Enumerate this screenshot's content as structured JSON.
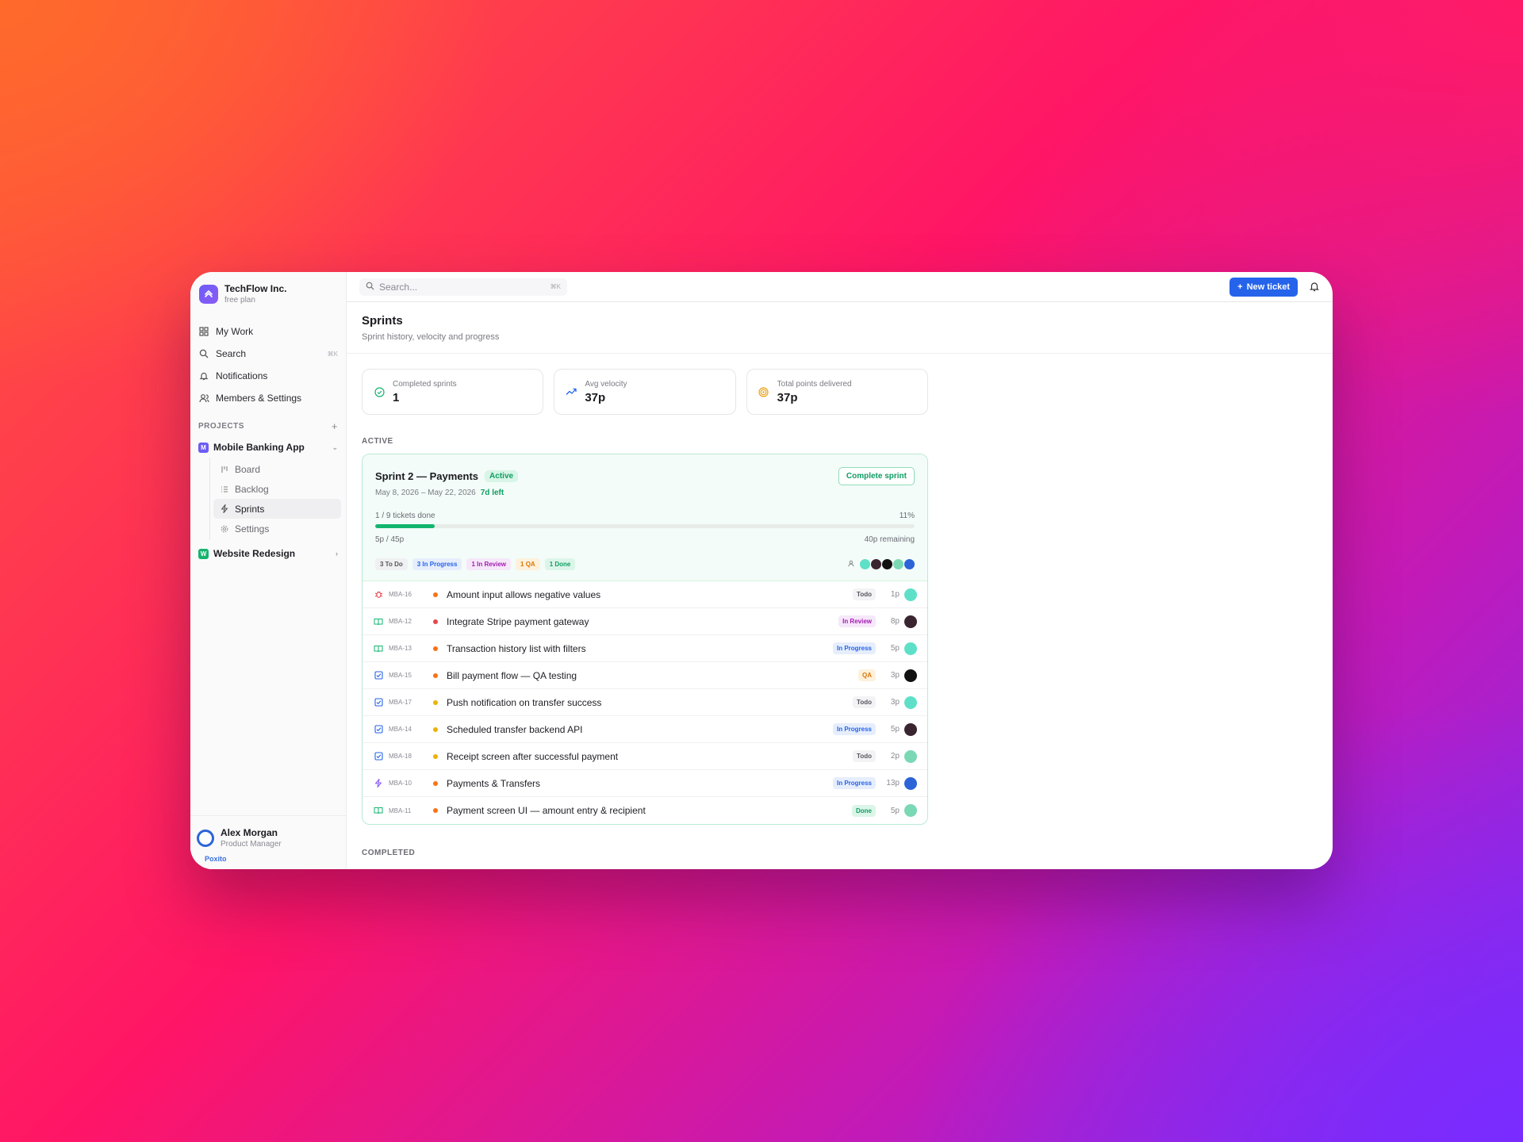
{
  "org": {
    "name": "TechFlow Inc.",
    "plan": "free plan"
  },
  "nav": [
    {
      "label": "My Work",
      "icon": "grid-icon"
    },
    {
      "label": "Search",
      "icon": "search-icon",
      "kbd": "⌘K"
    },
    {
      "label": "Notifications",
      "icon": "bell-icon"
    },
    {
      "label": "Members & Settings",
      "icon": "users-icon"
    }
  ],
  "projects_label": "PROJECTS",
  "projects": [
    {
      "name": "Mobile Banking App",
      "badge": "M",
      "color": "#6d5cf6",
      "subnav": [
        {
          "label": "Board"
        },
        {
          "label": "Backlog"
        },
        {
          "label": "Sprints",
          "active": true
        },
        {
          "label": "Settings"
        }
      ]
    },
    {
      "name": "Website Redesign",
      "badge": "W",
      "color": "#16b36e"
    }
  ],
  "user": {
    "name": "Alex Morgan",
    "role": "Product Manager",
    "brand": "Poxito"
  },
  "topbar": {
    "search_placeholder": "Search...",
    "search_kbd": "⌘K",
    "new_ticket": "New ticket"
  },
  "page": {
    "title": "Sprints",
    "subtitle": "Sprint history, velocity and progress"
  },
  "stats": [
    {
      "label": "Completed sprints",
      "value": "1",
      "icon": "check-circle-icon",
      "color": "#13b56f"
    },
    {
      "label": "Avg velocity",
      "value": "37p",
      "icon": "trend-up-icon",
      "color": "#2563eb"
    },
    {
      "label": "Total points delivered",
      "value": "37p",
      "icon": "target-icon",
      "color": "#e8a317"
    }
  ],
  "active_label": "ACTIVE",
  "sprint": {
    "name": "Sprint 2 — Payments",
    "status": "Active",
    "complete_label": "Complete sprint",
    "dates": "May 8, 2026 – May 22, 2026",
    "days_left": "7d left",
    "tickets_done": "1 / 9 tickets done",
    "percent_label": "11%",
    "progress_fraction": 0.11,
    "points": "5p / 45p",
    "remaining": "40p remaining",
    "chips": [
      {
        "label": "3 To Do",
        "color": "#55555e",
        "bg": "#f0f0f2"
      },
      {
        "label": "3 In Progress",
        "color": "#2563eb",
        "bg": "#e6eefc"
      },
      {
        "label": "1 In Review",
        "color": "#a21caf",
        "bg": "#f6e7fa"
      },
      {
        "label": "1 QA",
        "color": "#d97706",
        "bg": "#fdf1dc"
      },
      {
        "label": "1 Done",
        "color": "#0f9d63",
        "bg": "#dcf5e9"
      }
    ],
    "avatar_colors": [
      "#5ee0c8",
      "#3a2430",
      "#111111",
      "#7bd8b5",
      "#2c64d8"
    ]
  },
  "tickets": [
    {
      "id": "MBA-16",
      "type": "bug-icon",
      "type_color": "#e5484d",
      "prio": "#f97316",
      "title": "Amount input allows negative values",
      "status": "Todo",
      "s_color": "#55555e",
      "s_bg": "#f3f3f5",
      "points": "1p",
      "avatar": "#5ee0c8"
    },
    {
      "id": "MBA-12",
      "type": "story-icon",
      "type_color": "#13b56f",
      "prio": "#e5484d",
      "title": "Integrate Stripe payment gateway",
      "status": "In Review",
      "s_color": "#a21caf",
      "s_bg": "#f6e7fa",
      "points": "8p",
      "avatar": "#3a2430"
    },
    {
      "id": "MBA-13",
      "type": "story-icon",
      "type_color": "#13b56f",
      "prio": "#f97316",
      "title": "Transaction history list with filters",
      "status": "In Progress",
      "s_color": "#2563eb",
      "s_bg": "#e6eefc",
      "points": "5p",
      "avatar": "#5ee0c8"
    },
    {
      "id": "MBA-15",
      "type": "task-icon",
      "type_color": "#2563eb",
      "prio": "#f97316",
      "title": "Bill payment flow — QA testing",
      "status": "QA",
      "s_color": "#d97706",
      "s_bg": "#fdf1dc",
      "points": "3p",
      "avatar": "#111111"
    },
    {
      "id": "MBA-17",
      "type": "task-icon",
      "type_color": "#2563eb",
      "prio": "#eab308",
      "title": "Push notification on transfer success",
      "status": "Todo",
      "s_color": "#55555e",
      "s_bg": "#f3f3f5",
      "points": "3p",
      "avatar": "#5ee0c8"
    },
    {
      "id": "MBA-14",
      "type": "task-icon",
      "type_color": "#2563eb",
      "prio": "#eab308",
      "title": "Scheduled transfer backend API",
      "status": "In Progress",
      "s_color": "#2563eb",
      "s_bg": "#e6eefc",
      "points": "5p",
      "avatar": "#3a2430"
    },
    {
      "id": "MBA-18",
      "type": "task-icon",
      "type_color": "#2563eb",
      "prio": "#eab308",
      "title": "Receipt screen after successful payment",
      "status": "Todo",
      "s_color": "#55555e",
      "s_bg": "#f3f3f5",
      "points": "2p",
      "avatar": "#7bd8b5"
    },
    {
      "id": "MBA-10",
      "type": "epic-icon",
      "type_color": "#8b5cf6",
      "prio": "#f97316",
      "title": "Payments & Transfers",
      "status": "In Progress",
      "s_color": "#2563eb",
      "s_bg": "#e6eefc",
      "points": "13p",
      "avatar": "#2c64d8"
    },
    {
      "id": "MBA-11",
      "type": "story-icon",
      "type_color": "#13b56f",
      "prio": "#f97316",
      "title": "Payment screen UI — amount entry & recipient",
      "status": "Done",
      "s_color": "#0f9d63",
      "s_bg": "#dcf5e9",
      "points": "5p",
      "avatar": "#7bd8b5"
    }
  ],
  "completed_label": "COMPLETED"
}
